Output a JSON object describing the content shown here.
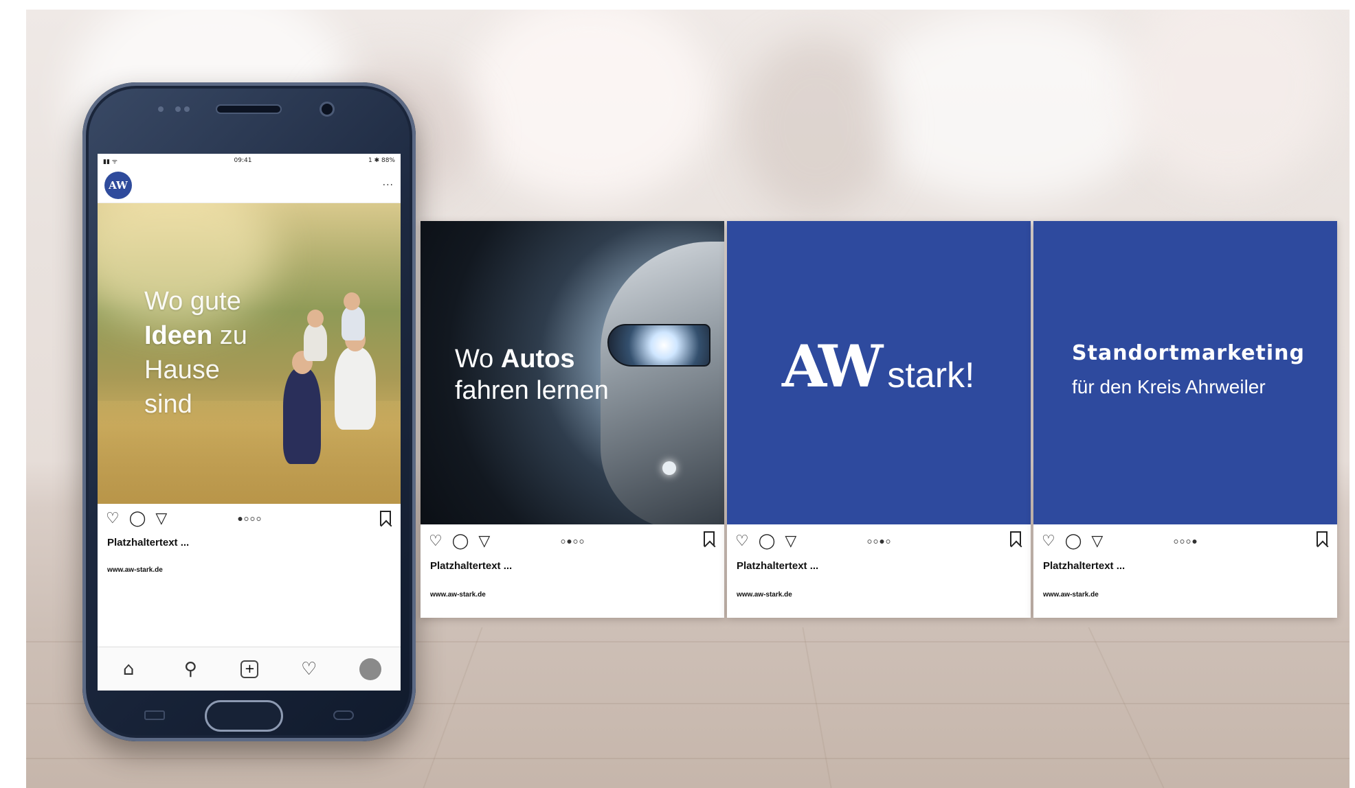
{
  "phone": {
    "status_time": "09:41",
    "status_right": "1 ✱ 88%",
    "avatar_text": "AW",
    "menu_dots": "···",
    "post_text": {
      "line1": "Wo gute",
      "line2_bold": "Ideen",
      "line2_rest": " zu",
      "line3": "Hause",
      "line4": "sind"
    },
    "pager_active": 0,
    "caption": "Platzhaltertext ...",
    "url": "www.aw-stark.de",
    "tabbar_icons": [
      "home-icon",
      "search-icon",
      "add-icon",
      "heart-icon",
      "profile-icon"
    ]
  },
  "cards": [
    {
      "car_text_light": "Wo ",
      "car_text_bold": "Autos",
      "car_text_line2": "fahren lernen",
      "caption": "Platzhaltertext ...",
      "url": "www.aw-stark.de"
    },
    {
      "logo_mark": "AW",
      "logo_word": "stark!",
      "caption": "Platzhaltertext ...",
      "url": "www.aw-stark.de"
    },
    {
      "headline": "Standortmarketing",
      "subline": "für den Kreis Ahrweiler",
      "caption": "Platzhaltertext ...",
      "url": "www.aw-stark.de"
    }
  ],
  "colors": {
    "brand_blue": "#2e4a9e",
    "card_bg": "#ffffff"
  }
}
